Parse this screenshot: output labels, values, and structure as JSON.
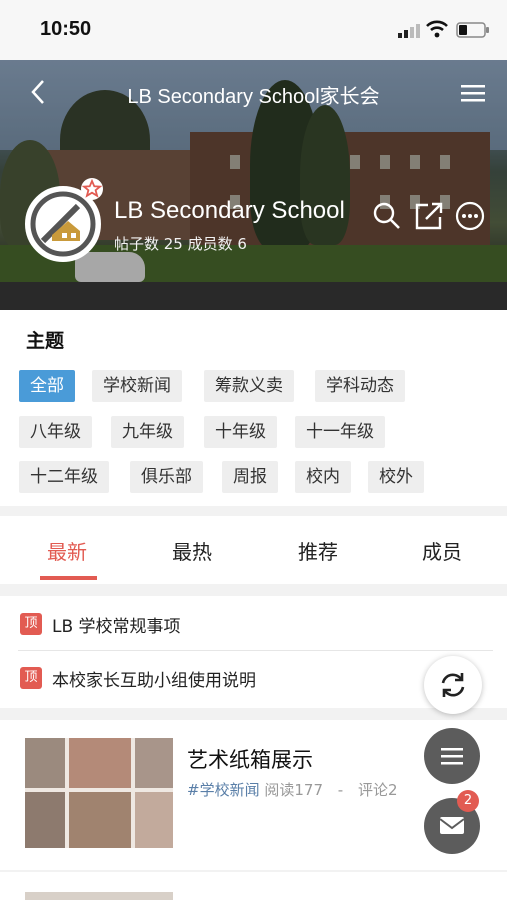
{
  "status_bar": {
    "time": "10:50"
  },
  "nav": {
    "title": "LB Secondary School家长会",
    "back_icon": "chevron-left-icon",
    "menu_icon": "hamburger-icon"
  },
  "group": {
    "name": "LB Secondary School",
    "stats": "帖子数  25  成员数  6"
  },
  "topics": {
    "title": "主题",
    "tags": [
      "全部",
      "学校新闻",
      "筹款义卖",
      "学科动态",
      "八年级",
      "九年级",
      "十年级",
      "十一年级",
      "十二年级",
      "俱乐部",
      "周报",
      "校内",
      "校外"
    ],
    "active": "全部"
  },
  "tabs": [
    "最新",
    "最热",
    "推荐",
    "成员"
  ],
  "pinned": [
    {
      "badge": "顶",
      "text": "LB 学校常规事项"
    },
    {
      "badge": "顶",
      "text": "本校家长互助小组使用说明"
    }
  ],
  "posts": [
    {
      "title": "艺术纸箱展示",
      "topic": "#学校新闻",
      "reads": "阅读177",
      "sep": "-",
      "comments": "评论2"
    }
  ],
  "mail_badge": "2",
  "colors": {
    "accent": "#e25b52",
    "active_tag": "#4a9bd8",
    "fab": "#5c5c5c"
  }
}
